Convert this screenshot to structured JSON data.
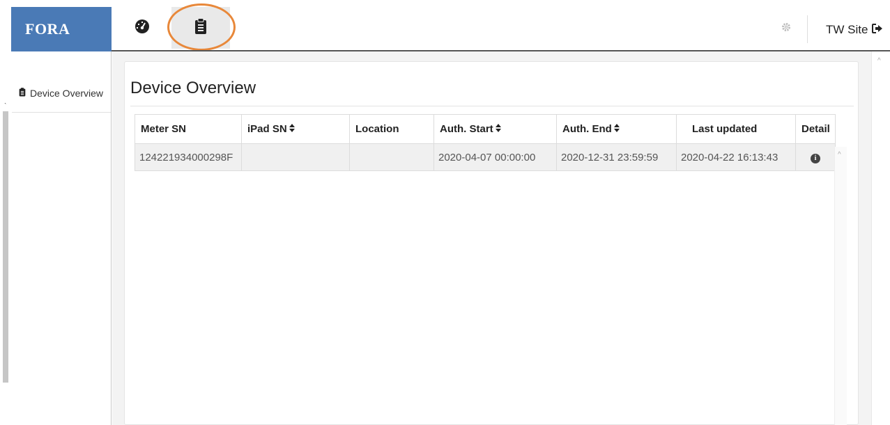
{
  "brand": {
    "logo_text": "FORA",
    "color": "#4a7ab6"
  },
  "header": {
    "nav": [
      {
        "name": "dashboard",
        "icon": "tachometer-icon"
      },
      {
        "name": "device-overview",
        "icon": "clipboard-icon",
        "active": true
      }
    ],
    "settings_icon": "gear-icon",
    "site_label": "TW Site",
    "logout_icon": "sign-out-icon",
    "highlight_color": "#e8883a"
  },
  "sidebar": {
    "items": [
      {
        "label": "Device Overview",
        "icon": "clipboard-icon"
      }
    ]
  },
  "main": {
    "title": "Device Overview",
    "table": {
      "columns": [
        {
          "label": "Meter SN",
          "sortable": false
        },
        {
          "label": "iPad SN",
          "sortable": true
        },
        {
          "label": "Location",
          "sortable": false
        },
        {
          "label": "Auth. Start",
          "sortable": true
        },
        {
          "label": "Auth. End",
          "sortable": true
        },
        {
          "label": "Last updated",
          "sortable": false
        },
        {
          "label": "Detail",
          "sortable": false
        }
      ],
      "rows": [
        {
          "meter_sn": "124221934000298F",
          "ipad_sn": "",
          "location": "",
          "auth_start": "2020-04-07 00:00:00",
          "auth_end": "2020-12-31 23:59:59",
          "last_updated": "2020-04-22 16:13:43",
          "detail_icon": "info-circle-icon"
        }
      ]
    }
  }
}
